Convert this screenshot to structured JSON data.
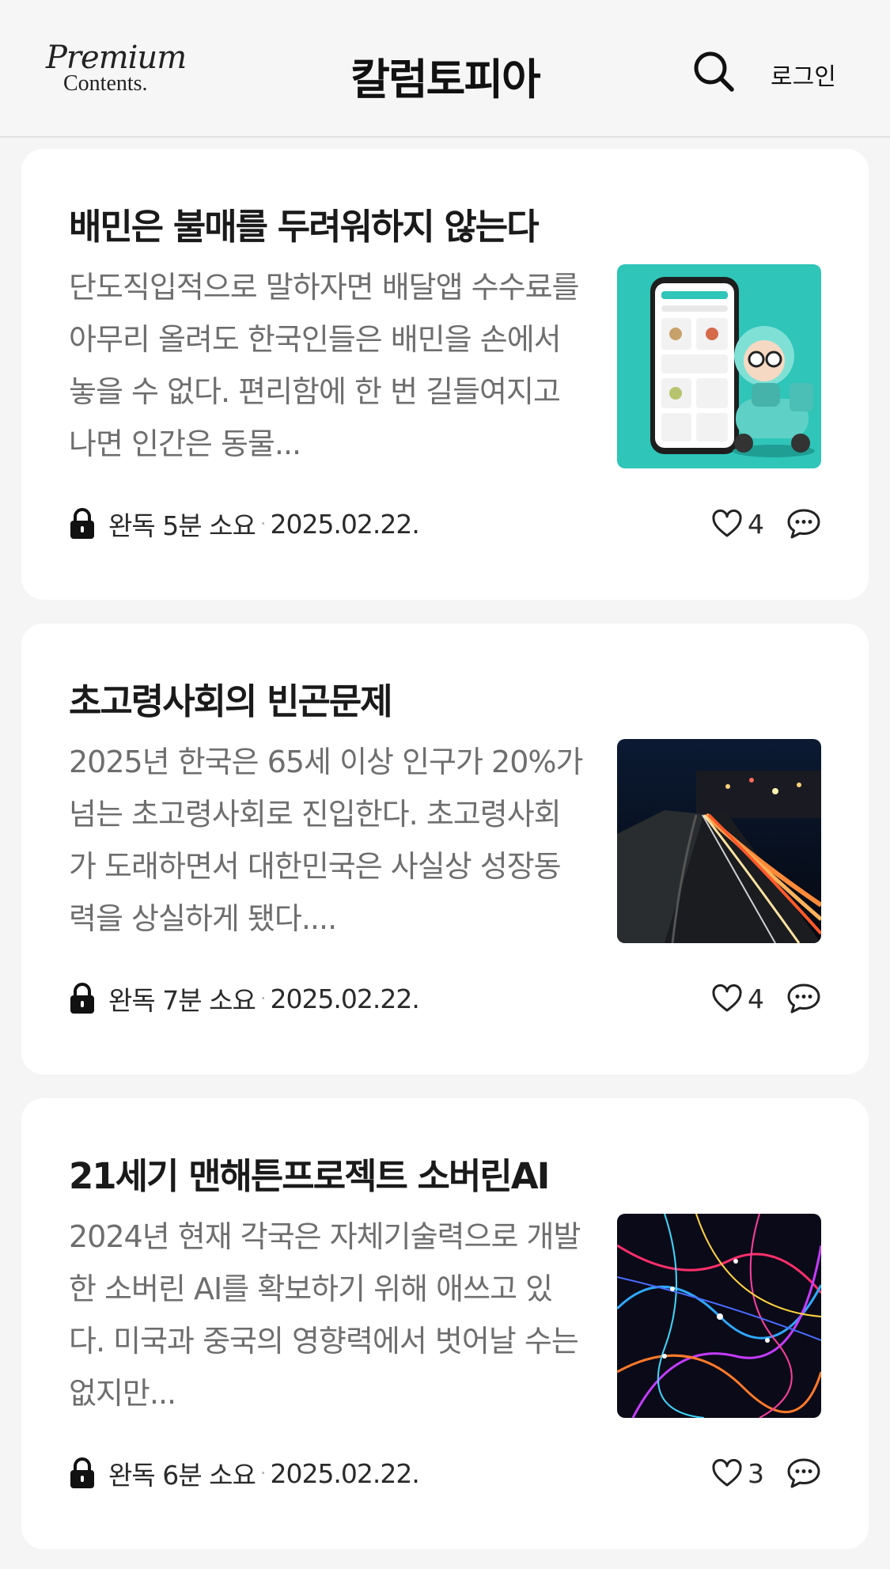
{
  "header": {
    "logo_line1": "Premium",
    "logo_line2": "Contents.",
    "title": "칼럼토피아",
    "search_icon": "search-icon",
    "login_label": "로그인"
  },
  "articles": [
    {
      "title": "배민은 불매를 두려워하지 않는다",
      "summary": "단도직입적으로 말하자면 배달앱 수수료를 아무리 올려도 한국인들은 배민을 손에서 놓을 수 없다. 편리함에 한 번 길들여지고 나면 인간은 동물...",
      "read_status": "완독",
      "read_time": "5분 소요",
      "date": "2025.02.22.",
      "likes": "4",
      "thumbnail": "delivery-app-illustration"
    },
    {
      "title": "초고령사회의 빈곤문제",
      "summary": "2025년 한국은 65세 이상 인구가 20%가 넘는 초고령사회로 진입한다. 초고령사회가 도래하면서 대한민국은 사실상 성장동력을 상실하게 됐다....",
      "read_status": "완독",
      "read_time": "7분 소요",
      "date": "2025.02.22.",
      "likes": "4",
      "thumbnail": "night-traffic-photo"
    },
    {
      "title": "21세기 맨해튼프로젝트 소버린AI",
      "summary": "2024년 현재 각국은 자체기술력으로 개발한 소버린 AI를 확보하기 위해 애쓰고 있다. 미국과 중국의 영향력에서 벗어날 수는 없지만...",
      "read_status": "완독",
      "read_time": "6분 소요",
      "date": "2025.02.22.",
      "likes": "3",
      "thumbnail": "neural-network-image"
    }
  ]
}
